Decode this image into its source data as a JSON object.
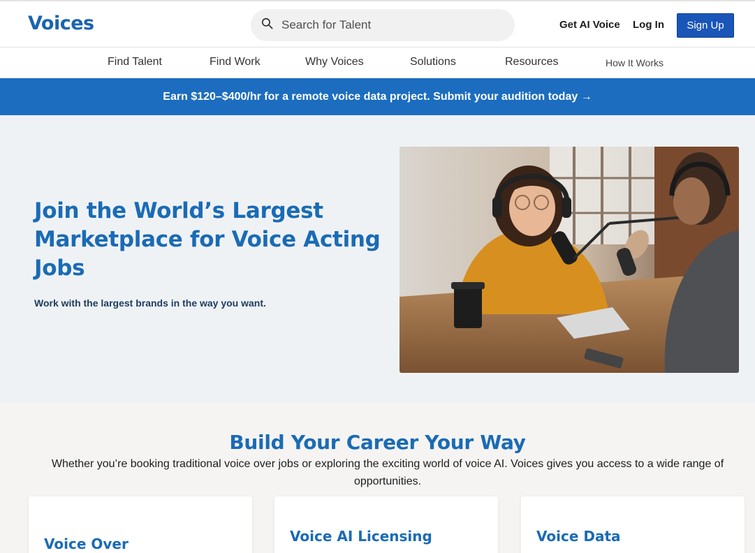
{
  "header": {
    "logo": "Voices",
    "search_placeholder": "Search for Talent",
    "get_ai_voice": "Get AI Voice",
    "log_in": "Log In",
    "sign_up": "Sign Up"
  },
  "nav": {
    "items": [
      "Find Talent",
      "Find Work",
      "Why Voices",
      "Solutions",
      "Resources",
      "How It Works"
    ]
  },
  "banner": {
    "text": "Earn $120–$400/hr for a remote voice data project. Submit your audition today →"
  },
  "hero": {
    "title": "Join the World’s Largest Marketplace for Voice Acting Jobs",
    "subtitle": "Work with the largest brands in the way you want."
  },
  "career": {
    "title": "Build Your Career Your Way",
    "description": "Whether you’re booking traditional voice over jobs or exploring the exciting world of voice AI. Voices gives you access to a wide range of opportunities.",
    "cards": [
      {
        "title": "Voice Over"
      },
      {
        "title": "Voice AI Licensing"
      },
      {
        "title": "Voice Data"
      }
    ]
  },
  "colors": {
    "brand_blue": "#1a6bb5",
    "banner_blue": "#1c6dbf",
    "button_blue": "#1a56b8"
  }
}
